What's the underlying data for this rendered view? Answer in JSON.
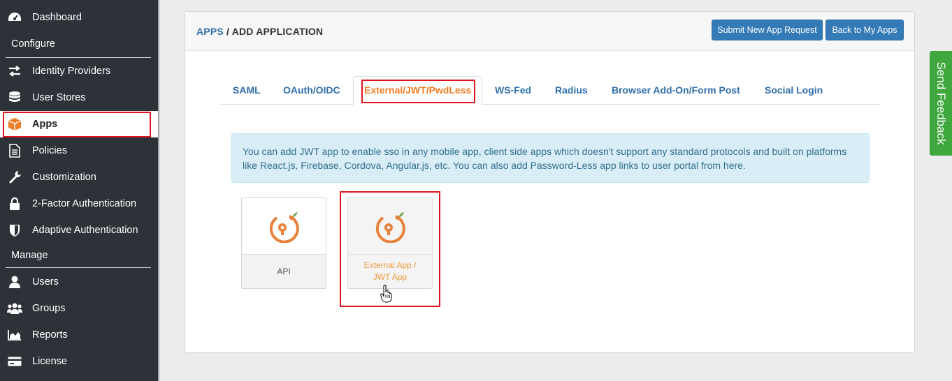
{
  "sidebar": {
    "items": [
      {
        "label": "Dashboard",
        "icon": "dashboard-icon"
      },
      {
        "label": "Identity Providers",
        "icon": "arrows-exchange-icon"
      },
      {
        "label": "User Stores",
        "icon": "database-icon"
      },
      {
        "label": "Apps",
        "icon": "cube-icon",
        "active": true
      },
      {
        "label": "Policies",
        "icon": "document-icon"
      },
      {
        "label": "Customization",
        "icon": "wrench-icon"
      },
      {
        "label": "2-Factor Authentication",
        "icon": "lock-icon"
      },
      {
        "label": "Adaptive Authentication",
        "icon": "shield-icon"
      },
      {
        "label": "Users",
        "icon": "user-icon"
      },
      {
        "label": "Groups",
        "icon": "users-icon"
      },
      {
        "label": "Reports",
        "icon": "area-chart-icon"
      },
      {
        "label": "License",
        "icon": "credit-card-icon"
      }
    ],
    "sections": {
      "configure": "Configure",
      "manage": "Manage"
    }
  },
  "header": {
    "crumb_link": "APPS",
    "crumb_sep": " / ",
    "crumb_current": "ADD APPLICATION",
    "submit_button": "Submit New App Request",
    "back_button": "Back to My Apps"
  },
  "tabs": [
    {
      "label": "SAML"
    },
    {
      "label": "OAuth/OIDC"
    },
    {
      "label": "External/JWT/PwdLess",
      "active": true
    },
    {
      "label": "WS-Fed"
    },
    {
      "label": "Radius"
    },
    {
      "label": "Browser Add-On/Form Post"
    },
    {
      "label": "Social Login"
    }
  ],
  "alert": {
    "text": "You can add JWT app to enable sso in any mobile app, client side apps which doesn't support any standard protocols and built on platforms like React.js, Firebase, Cordova, Angular.js, etc. You can also add Password-Less app links to user portal from here."
  },
  "tiles": [
    {
      "label": "API"
    },
    {
      "label": "External App / JWT App"
    }
  ],
  "feedback": {
    "label": "Send Feedback"
  },
  "colors": {
    "sidebar_bg": "#2c3238",
    "link_blue": "#2f6fab",
    "button_blue": "#337ab7",
    "accent_orange": "#ef7d26",
    "highlight_red": "#e0141e",
    "feedback_green": "#3ea73e"
  }
}
